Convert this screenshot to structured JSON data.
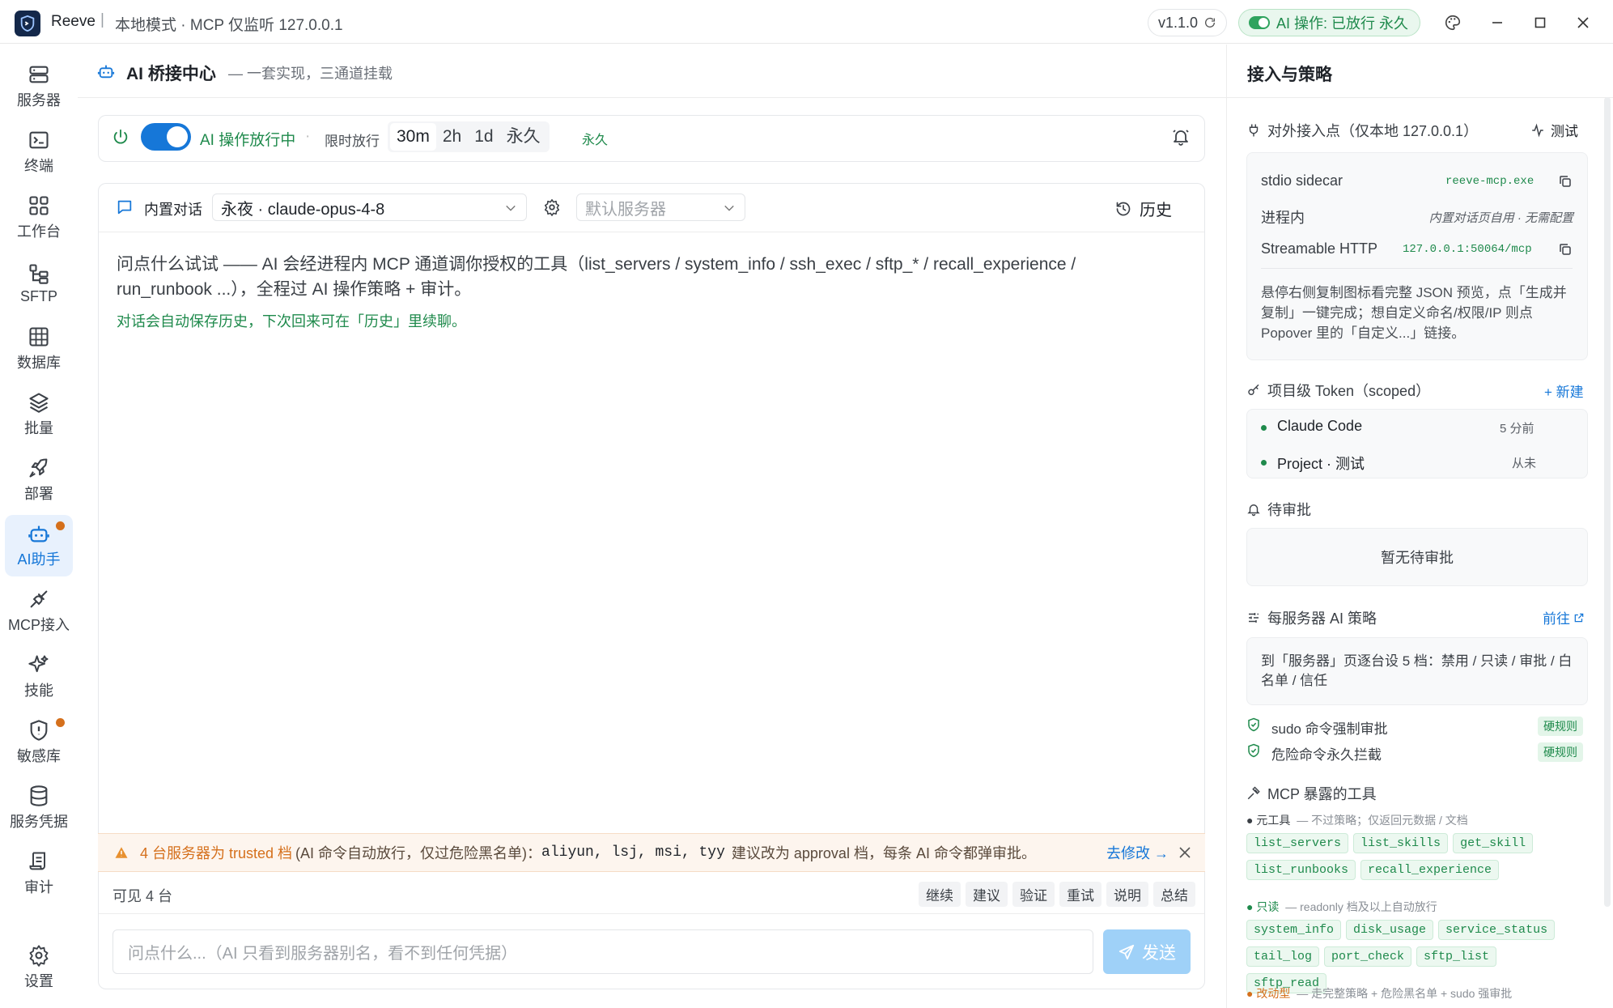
{
  "titlebar": {
    "app_name": "Reeve",
    "separator": "|",
    "mode": "本地模式 · MCP 仅监听 127.0.0.1",
    "version": "v1.1.0",
    "ai_status": "AI 操作: 已放行 永久"
  },
  "sidebar": {
    "items": [
      {
        "label": "服务器",
        "icon": "server-icon"
      },
      {
        "label": "终端",
        "icon": "terminal-icon"
      },
      {
        "label": "工作台",
        "icon": "dashboard-icon"
      },
      {
        "label": "SFTP",
        "icon": "sftp-icon"
      },
      {
        "label": "数据库",
        "icon": "table-icon"
      },
      {
        "label": "批量",
        "icon": "layers-icon"
      },
      {
        "label": "部署",
        "icon": "rocket-icon"
      },
      {
        "label": "AI助手",
        "icon": "bot-icon"
      },
      {
        "label": "MCP接入",
        "icon": "plug-icon"
      },
      {
        "label": "技能",
        "icon": "sparkles-icon"
      },
      {
        "label": "敏感库",
        "icon": "shield-alert-icon"
      },
      {
        "label": "服务凭据",
        "icon": "database-icon"
      },
      {
        "label": "审计",
        "icon": "scroll-icon"
      },
      {
        "label": "设置",
        "icon": "gear-icon"
      }
    ]
  },
  "main": {
    "title": "AI 桥接中心",
    "subtitle": "— 一套实现，三通道挂载",
    "toggle_label": "AI 操作放行中",
    "dot": "·",
    "limit_label": "限时放行",
    "durations": [
      "30m",
      "2h",
      "1d",
      "永久"
    ],
    "selected_duration": "永久",
    "chat_label": "内置对话",
    "model": "永夜 · claude-opus-4-8",
    "server_placeholder": "默认服务器",
    "history": "历史",
    "intro": "问点什么试试 —— AI 会经进程内 MCP 通道调你授权的工具（list_servers / system_info / ssh_exec / sftp_* / recall_experience / run_runbook ...），全程过 AI 操作策略 + 审计。",
    "intro_note": "对话会自动保存历史，下次回来可在「历史」里续聊。",
    "warn_head": "4 台服务器为 trusted 档",
    "warn_body": "(AI 命令自动放行，仅过危险黑名单)：",
    "warn_servers": "aliyun, lsj, msi, tyy",
    "warn_tail": "建议改为 approval 档，每条 AI 命令都弹审批。",
    "warn_link": "去修改 →",
    "visible": "可见 4 台",
    "quick": [
      "继续",
      "建议",
      "验证",
      "重试",
      "说明",
      "总结"
    ],
    "input_placeholder": "问点什么...（AI 只看到服务器别名，看不到任何凭据）",
    "send": "发送"
  },
  "panel": {
    "title": "接入与策略",
    "endpoint_title": "对外接入点（仅本地 127.0.0.1）",
    "test": "测试",
    "endpoints": [
      {
        "name": "stdio sidecar",
        "value": "reeve-mcp.exe"
      },
      {
        "name": "进程内",
        "value": "内置对话页自用 · 无需配置"
      },
      {
        "name": "Streamable HTTP",
        "value": "127.0.0.1:50064/mcp"
      }
    ],
    "endpoint_note": "悬停右侧复制图标看完整 JSON 预览，点「生成并复制」一键完成；想自定义命名/权限/IP 则点 Popover 里的「自定义...」链接。",
    "token_title": "项目级 Token（scoped）",
    "new_token": "+ 新建",
    "tokens": [
      {
        "name": "Claude Code",
        "time": "5 分前"
      },
      {
        "name": "Project · 测试",
        "time": "从未"
      }
    ],
    "pending_title": "待审批",
    "pending_empty": "暂无待审批",
    "policy_title": "每服务器 AI 策略",
    "goto": "前往",
    "policy_note": "到「服务器」页逐台设 5 档：禁用 / 只读 / 审批 / 白名单 / 信任",
    "rules": [
      {
        "label": "sudo 命令强制审批",
        "tag": "硬规则"
      },
      {
        "label": "危险命令永久拦截",
        "tag": "硬规则"
      }
    ],
    "tools_title": "MCP 暴露的工具",
    "meta_label": "元工具",
    "meta_note": "— 不过策略；仅返回元数据 / 文档",
    "meta_tools": [
      "list_servers",
      "list_skills",
      "get_skill",
      "list_runbooks",
      "recall_experience"
    ],
    "ro_label": "只读",
    "ro_note": "— readonly 档及以上自动放行",
    "ro_tools": [
      "system_info",
      "disk_usage",
      "service_status",
      "tail_log",
      "port_check",
      "sftp_list",
      "sftp_read"
    ],
    "rw_label": "改动型",
    "rw_note": "— 走完整策略 + 危险黑名单 + sudo 强审批"
  },
  "colors": {
    "accent": "#1677d8",
    "success": "#1f8a4c",
    "warning": "#d5701c"
  }
}
